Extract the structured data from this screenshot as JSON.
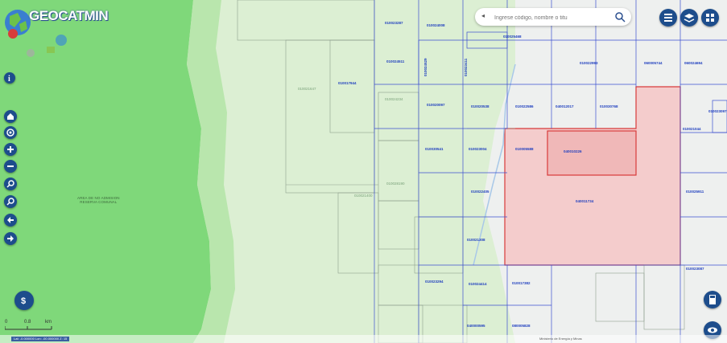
{
  "app": {
    "title": "GEOCATMIN",
    "subtitle": "",
    "badge": "",
    "accent": "#1d4d8c"
  },
  "search": {
    "placeholder": "Ingrese código, nombre o titu",
    "value": ""
  },
  "toolbar_right": [
    "layers-icon",
    "basemap-icon",
    "grid-icon"
  ],
  "toolbar_left": [
    "home-icon",
    "target-icon",
    "zoom-in-icon",
    "zoom-out-icon",
    "search-icon",
    "measure-icon",
    "back-icon",
    "forward-icon"
  ],
  "map": {
    "colors": {
      "green": "#7fd87a",
      "light_green": "#dcefd3",
      "pink": "#f4cccc",
      "grid_blue": "#3b4fd0",
      "grid_gray": "#8a9a8a",
      "red": "#d83b3b"
    },
    "area_label": {
      "line1": "AREA DE NO ADMISION",
      "line2": "RESERVA COMUNAL"
    },
    "labels": [
      {
        "text": "010023287"
      },
      {
        "text": "010024008"
      },
      {
        "text": "010025468"
      },
      {
        "text": "010024511"
      },
      {
        "text": "010024529"
      },
      {
        "text": "010023411"
      },
      {
        "text": "010022993"
      },
      {
        "text": "060005744"
      },
      {
        "text": "060024694"
      },
      {
        "text": "010017944"
      },
      {
        "text": "010021647"
      },
      {
        "text": "010020097"
      },
      {
        "text": "010020538"
      },
      {
        "text": "010022586"
      },
      {
        "text": "040012017"
      },
      {
        "text": "010030768"
      },
      {
        "text": "010023097"
      },
      {
        "text": "010021044"
      },
      {
        "text": "010030541"
      },
      {
        "text": "010023004"
      },
      {
        "text": "010005588"
      },
      {
        "text": "040010226"
      },
      {
        "text": "010022405"
      },
      {
        "text": "040011734"
      },
      {
        "text": "010025911"
      },
      {
        "text": "010021308"
      },
      {
        "text": "010023294"
      },
      {
        "text": "010024414"
      },
      {
        "text": "010017382"
      },
      {
        "text": "010023087"
      },
      {
        "text": "040000595"
      },
      {
        "text": "080005828"
      },
      {
        "text": "010024234"
      },
      {
        "text": "010028190"
      },
      {
        "text": "010021400"
      }
    ],
    "scale": {
      "zero": "0",
      "mid": "0.8",
      "unit": "km"
    },
    "status": "Lat: -0.000000 Lon: -00.000000 Z: 15",
    "credits": "Ministerio de Energía y Minas"
  }
}
